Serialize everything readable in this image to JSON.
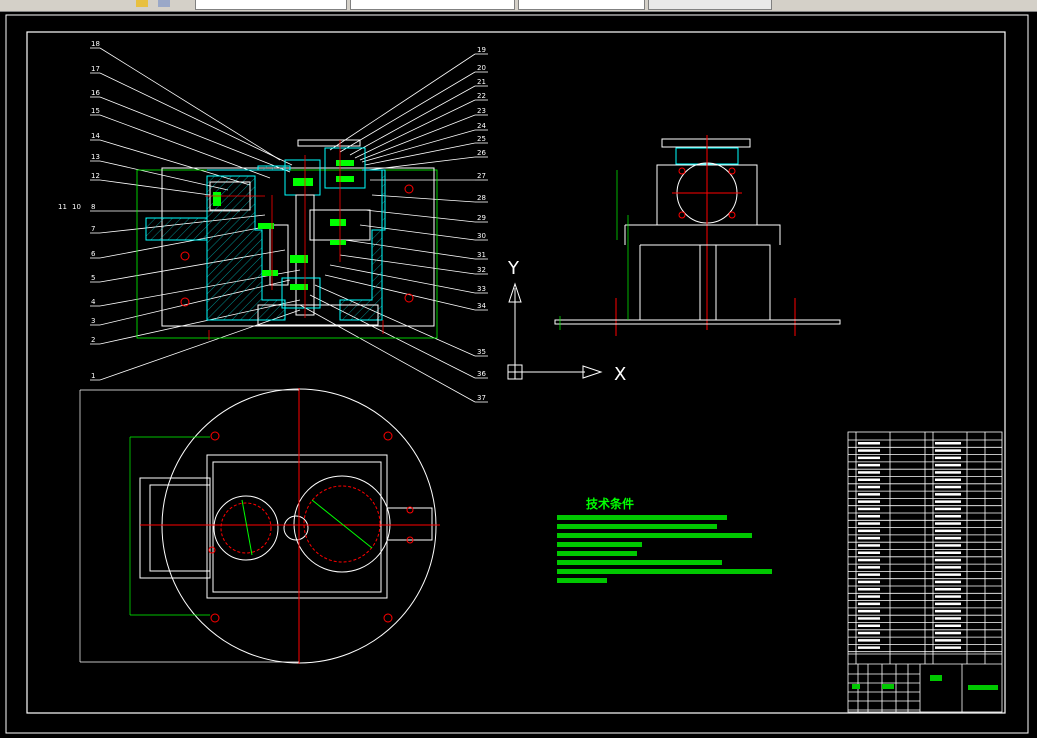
{
  "toolbar": {
    "tabs": [
      "",
      "",
      "",
      ""
    ]
  },
  "drawing": {
    "background": "#000000",
    "colors": {
      "outline": "#ffffff",
      "hatch": "#00ffff",
      "center": "#ff0000",
      "bearing": "#00ff00",
      "text": "#00ff00"
    },
    "left_leaders": [
      "18",
      "17",
      "16",
      "15",
      "14",
      "13",
      "12",
      "8",
      "7",
      "6",
      "5",
      "4",
      "3",
      "2",
      "1"
    ],
    "left_leader_extra": [
      "11",
      "10"
    ],
    "right_leaders": [
      "19",
      "20",
      "21",
      "22",
      "23",
      "24",
      "25",
      "26",
      "27",
      "28",
      "29",
      "30",
      "31",
      "32",
      "33",
      "34",
      "35",
      "36",
      "37"
    ],
    "axis": {
      "y_label": "Y",
      "x_label": "X"
    },
    "tech_requirements": {
      "title": "技术条件"
    }
  }
}
